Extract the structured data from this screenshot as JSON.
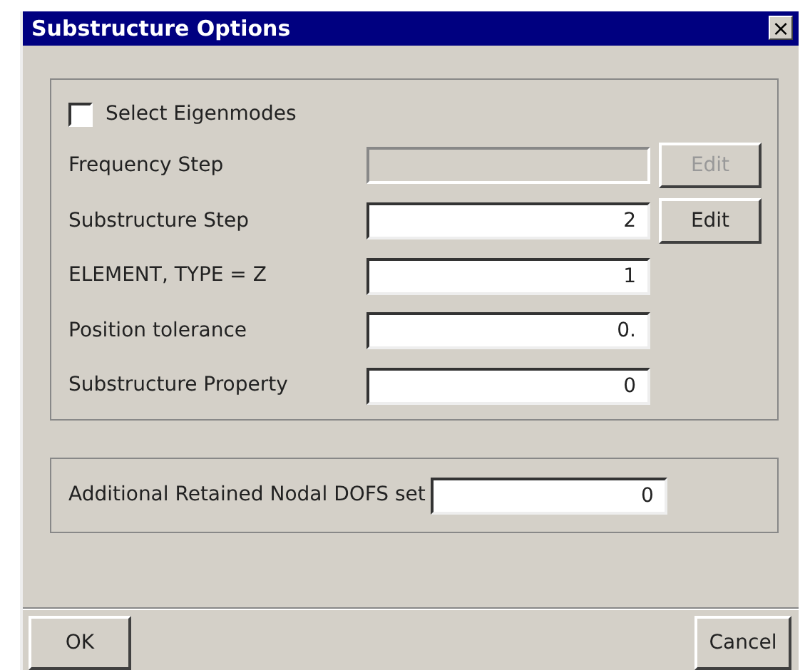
{
  "window": {
    "title": "Substructure Options",
    "close_label": "×"
  },
  "options": {
    "checkbox": {
      "label": "Select Eigenmodes",
      "checked": false
    },
    "fields": [
      {
        "label": "Frequency Step",
        "disabled": true,
        "edit_button": {
          "label": "Edit",
          "disabled": true
        }
      },
      {
        "label": "Substructure Step",
        "value": "2",
        "disabled": false,
        "edit_button": {
          "label": "Edit",
          "disabled": false
        }
      },
      {
        "label": "ELEMENT, TYPE = Z",
        "value": "1",
        "disabled": false
      },
      {
        "label": "Position tolerance",
        "value": "0.",
        "disabled": false
      },
      {
        "label": "Substructure Property",
        "value": "0",
        "disabled": false
      }
    ]
  },
  "retained": {
    "label": "Additional Retained Nodal DOFS set",
    "value": "0"
  },
  "buttons": [
    {
      "label": "OK"
    },
    {
      "label": "Cancel"
    }
  ]
}
